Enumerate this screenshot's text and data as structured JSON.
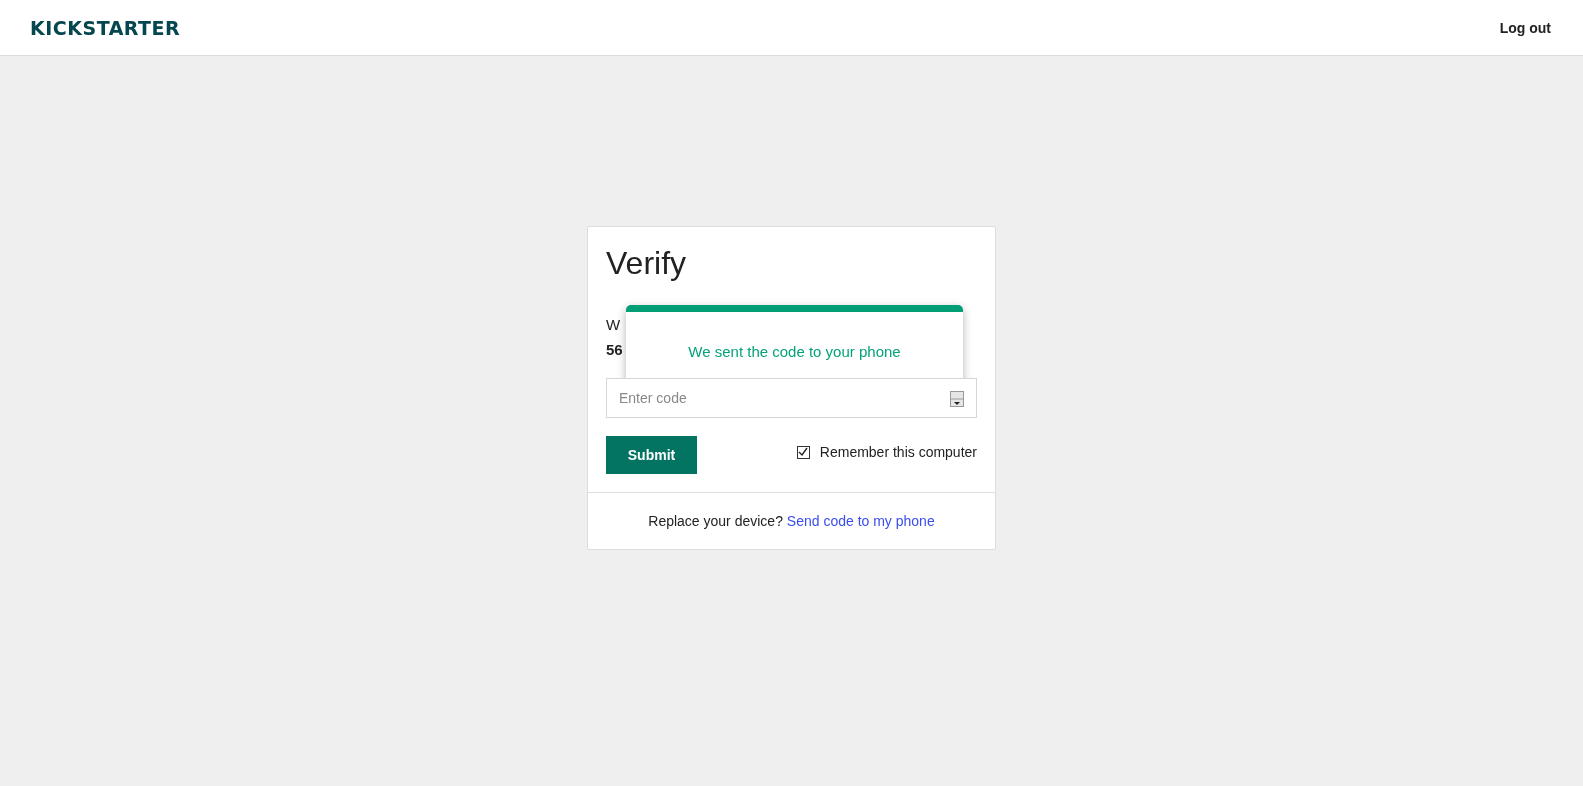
{
  "header": {
    "logo": "KICKSTARTER",
    "logout": "Log out"
  },
  "card": {
    "title": "Verify",
    "intro_line_1": "W",
    "intro_line_2": "56",
    "code_field": {
      "placeholder": "Enter code"
    },
    "submit": "Submit",
    "remember": {
      "label": "Remember this computer",
      "checked": true
    },
    "footer_text": "Replace your device?",
    "footer_link": "Send code to my phone"
  },
  "toast": {
    "message": "We sent the code to your phone"
  }
}
